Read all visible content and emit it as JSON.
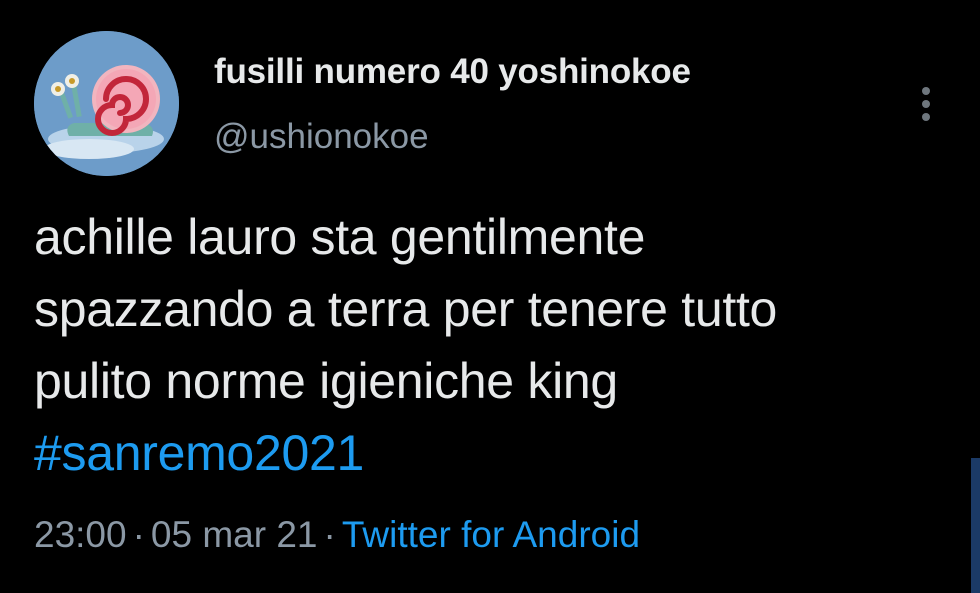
{
  "tweet": {
    "author": {
      "display_name": "fusilli numero 40 yoshinokoe",
      "handle": "@ushionokoe",
      "avatar_icon": "snail-shell-avatar"
    },
    "text_lines": [
      "achille lauro sta gentilmente",
      "spazzando a terra per tenere tutto",
      "pulito norme igieniche king"
    ],
    "hashtag": "#sanremo2021",
    "time": "23:00",
    "separator": "·",
    "date": "05 mar 21",
    "source": "Twitter for Android",
    "more_icon": "vertical-ellipsis-icon"
  },
  "colors": {
    "background": "#000000",
    "text": "#e7e9ea",
    "muted": "#8b98a5",
    "link": "#1d9bf0"
  }
}
